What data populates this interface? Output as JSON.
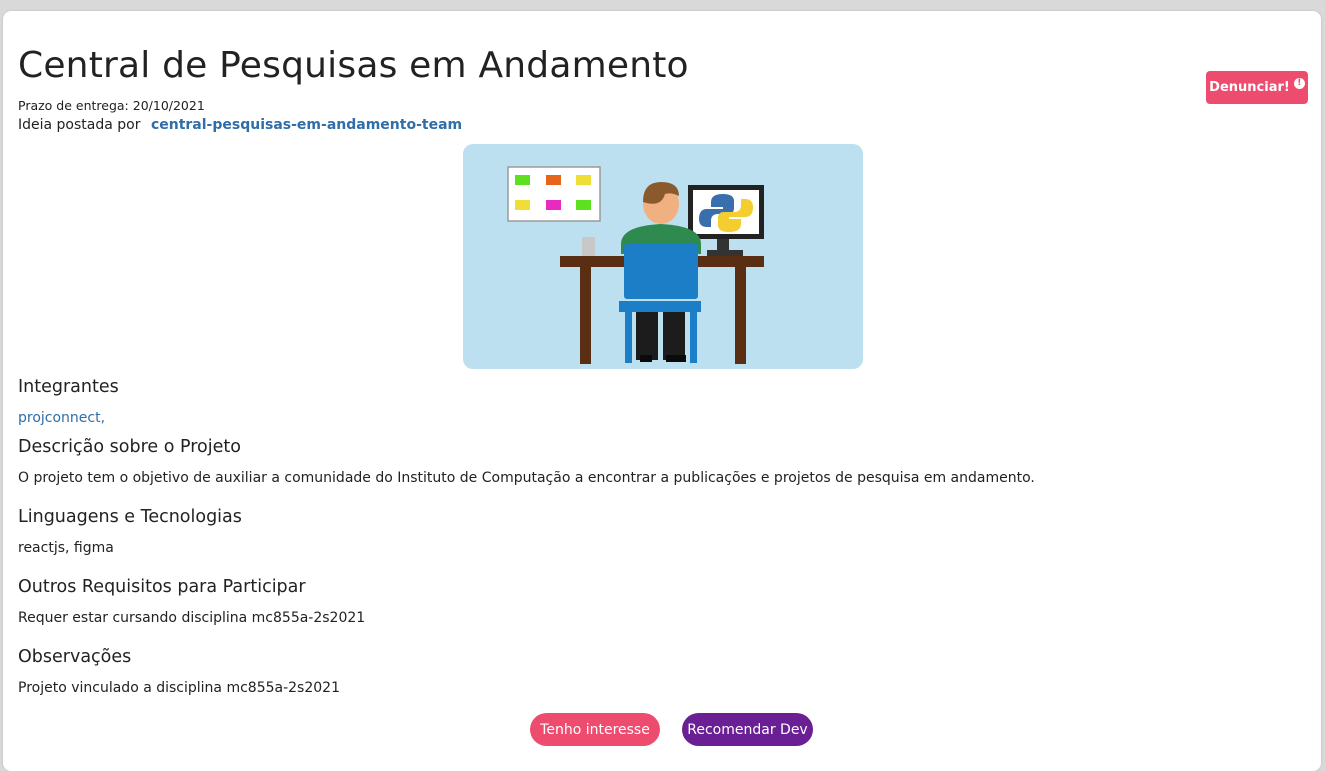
{
  "header": {
    "title": "Central de Pesquisas em Andamento",
    "deadline": "Prazo de entrega: 20/10/2021",
    "posted_by_label": "Ideia postada por",
    "posted_by_team": "central-pesquisas-em-andamento-team",
    "report_label": "Denunciar!",
    "report_icon": "exclamation-circle-icon"
  },
  "illustration": {
    "icon": "developer-at-desk-python-illustration"
  },
  "sections": {
    "members_title": "Integrantes",
    "members": [
      "projconnect,"
    ],
    "description_title": "Descrição sobre o Projeto",
    "description": "O projeto tem o objetivo de auxiliar a comunidade do Instituto de Computação a encontrar a publicações e projetos de pesquisa em andamento.",
    "tech_title": "Linguagens e Tecnologias",
    "tech": "reactjs, figma",
    "requirements_title": "Outros Requisitos para Participar",
    "requirements": "Requer estar cursando disciplina mc855a-2s2021",
    "notes_title": "Observações",
    "notes": "Projeto vinculado a disciplina mc855a-2s2021"
  },
  "actions": {
    "interest_label": "Tenho interesse",
    "recommend_label": "Recomendar Dev"
  },
  "colors": {
    "accent_pink": "#ee4c6e",
    "accent_purple": "#6a1f94",
    "link_blue": "#2f6ea8"
  }
}
